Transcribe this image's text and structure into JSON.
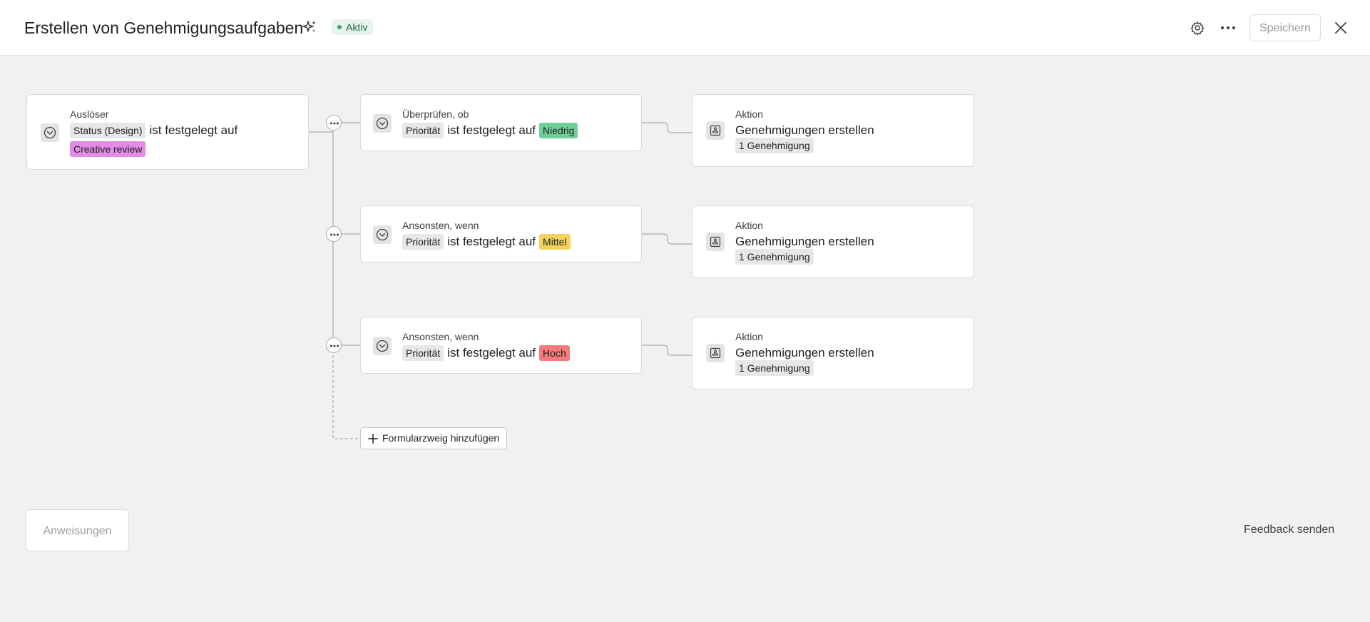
{
  "header": {
    "title": "Erstellen von Genehmigungsaufgaben",
    "status": "Aktiv",
    "save_label": "Speichern",
    "icons": [
      "sparkle-icon",
      "gear-icon",
      "more-icon",
      "close-icon"
    ]
  },
  "trigger": {
    "label": "Auslöser",
    "field": "Status (Design)",
    "operator": "ist festgelegt auf",
    "value": "Creative review"
  },
  "branches": [
    {
      "condition_label": "Überprüfen, ob",
      "field": "Priorität",
      "operator": "ist festgelegt auf",
      "value": "Niedrig",
      "value_color": "#6fcf97",
      "action_label": "Aktion",
      "action_title": "Genehmigungen erstellen",
      "action_count": "1 Genehmigung"
    },
    {
      "condition_label": "Ansonsten, wenn",
      "field": "Priorität",
      "operator": "ist festgelegt auf",
      "value": "Mittel",
      "value_color": "#f5d35b",
      "action_label": "Aktion",
      "action_title": "Genehmigungen erstellen",
      "action_count": "1 Genehmigung"
    },
    {
      "condition_label": "Ansonsten, wenn",
      "field": "Priorität",
      "operator": "ist festgelegt auf",
      "value": "Hoch",
      "value_color": "#f57b7b",
      "action_label": "Aktion",
      "action_title": "Genehmigungen erstellen",
      "action_count": "1 Genehmigung"
    }
  ],
  "add_branch_label": "Formularzweig hinzufügen",
  "footer": {
    "instructions_label": "Anweisungen",
    "feedback_label": "Feedback senden"
  }
}
